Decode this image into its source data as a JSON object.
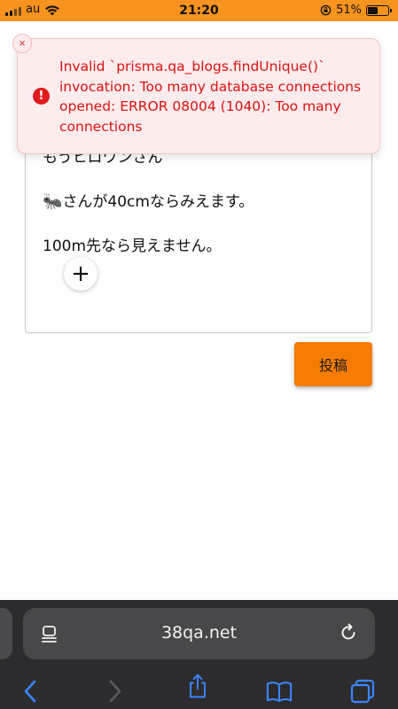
{
  "status_bar": {
    "carrier": "au",
    "time": "21:20",
    "battery_percent": "51%",
    "battery_level": 0.51
  },
  "editor": {
    "line1": "もうヒロワンさん",
    "line2_emoji": "🐜",
    "line2": "さんが40cmならみえます。",
    "line3": "100m先なら見えません。",
    "add_label": "+"
  },
  "submit_button": {
    "label": "投稿"
  },
  "error_toast": {
    "close_label": "×",
    "icon_label": "!",
    "message": "Invalid `prisma.qa_blogs.findUnique()` invocation: Too many database connections opened: ERROR 08004 (1040): Too many connections"
  },
  "browser": {
    "url": "38qa.net"
  },
  "colors": {
    "status_bar_bg": "#f7931e",
    "submit_bg": "#f57c00",
    "error_text": "#dd1212",
    "error_bg": "#fdecec",
    "browser_bar_bg": "#2c2c2e",
    "browser_icon": "#3a86ff"
  },
  "icons": {
    "signal": "cellular-signal-icon",
    "wifi": "wifi-icon",
    "rotation_lock": "rotation-lock-icon",
    "battery": "battery-icon",
    "reader": "reader-mode-icon",
    "reload": "reload-icon",
    "back": "back-chevron-icon",
    "forward": "forward-chevron-icon",
    "share": "share-icon",
    "bookmarks": "bookmarks-icon",
    "tabs": "tabs-icon"
  }
}
